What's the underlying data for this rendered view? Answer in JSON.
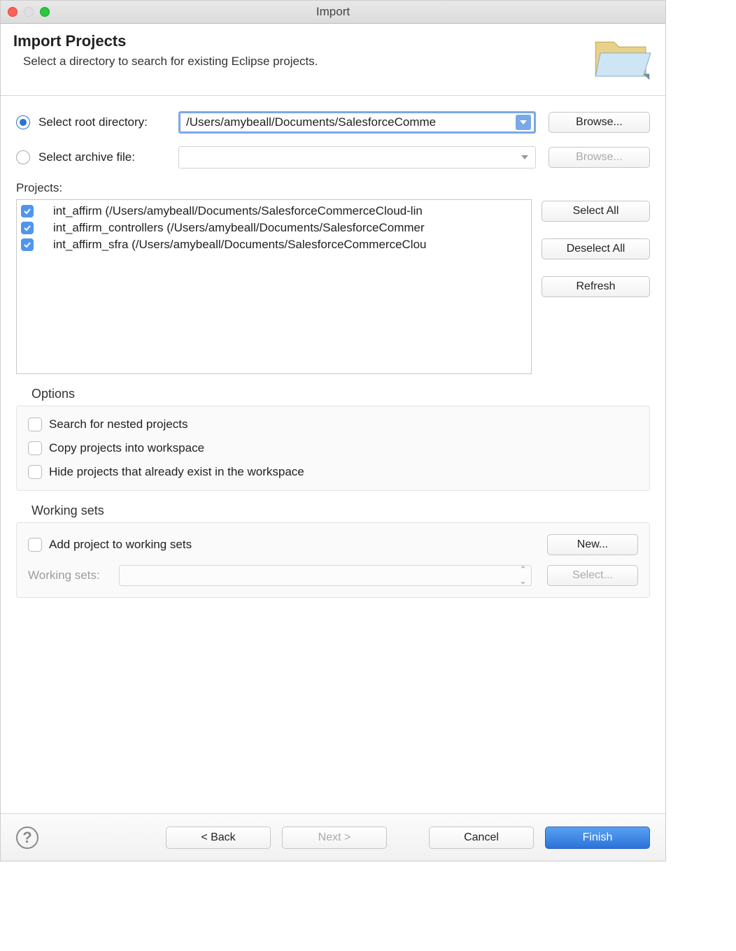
{
  "window": {
    "title": "Import"
  },
  "header": {
    "title": "Import Projects",
    "subtitle": "Select a directory to search for existing Eclipse projects."
  },
  "source": {
    "rootDirLabel": "Select root directory:",
    "rootDirValue": "/Users/amybeall/Documents/SalesforceComme",
    "archiveLabel": "Select archive file:",
    "archiveValue": "",
    "browseLabel": "Browse..."
  },
  "projects": {
    "label": "Projects:",
    "items": [
      "int_affirm (/Users/amybeall/Documents/SalesforceCommerceCloud-lin",
      "int_affirm_controllers (/Users/amybeall/Documents/SalesforceCommer",
      "int_affirm_sfra (/Users/amybeall/Documents/SalesforceCommerceClou"
    ],
    "selectAll": "Select All",
    "deselectAll": "Deselect All",
    "refresh": "Refresh"
  },
  "options": {
    "label": "Options",
    "nested": "Search for nested projects",
    "copy": "Copy projects into workspace",
    "hide": "Hide projects that already exist in the workspace"
  },
  "workingSets": {
    "label": "Working sets",
    "add": "Add project to working sets",
    "newBtn": "New...",
    "selectLabel": "Working sets:",
    "selectBtn": "Select..."
  },
  "footer": {
    "back": "< Back",
    "next": "Next >",
    "cancel": "Cancel",
    "finish": "Finish"
  }
}
